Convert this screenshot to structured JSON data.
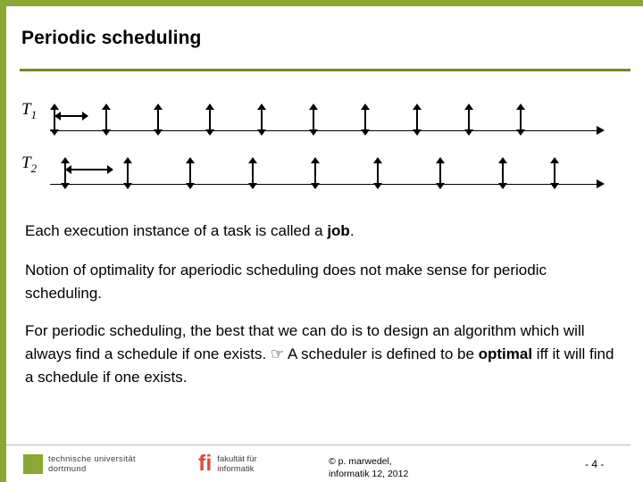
{
  "slide": {
    "title": "Periodic scheduling",
    "accent_color": "#8aa832",
    "rule_color": "#6f8a28"
  },
  "diagram": {
    "tasks": [
      {
        "label": "T",
        "subscript": "1"
      },
      {
        "label": "T",
        "subscript": "2"
      }
    ],
    "row1_markers": [
      60,
      118,
      176,
      234,
      292,
      350,
      408,
      466,
      524,
      582
    ],
    "row2_markers": [
      72,
      142,
      212,
      282,
      352,
      422,
      492,
      562,
      620
    ],
    "row1_period_arrow": {
      "start": 62,
      "end": 100
    },
    "row2_period_arrow": {
      "start": 74,
      "end": 128
    }
  },
  "content": {
    "paragraph1_a": "Each execution instance of a task is called a ",
    "paragraph1_b": "job",
    "paragraph1_c": ".",
    "paragraph2": "Notion of optimality for aperiodic scheduling does not make sense for periodic scheduling.",
    "paragraph3_a": "For periodic scheduling, the best that we can do is to design an algorithm which will always find a schedule if one exists.",
    "paragraph3_pointer": "☞",
    "paragraph3_b": " A scheduler is defined to be ",
    "paragraph3_bold": "optimal",
    "paragraph3_c": " iff it will find a schedule if one exists."
  },
  "footer": {
    "tu_logo_line1": "technische universität",
    "tu_logo_line2": "dortmund",
    "fi_logo_mark": "fi",
    "fi_logo_line1": "fakultät für",
    "fi_logo_line2": "informatik",
    "copyright_line1": "© p. marwedel,",
    "copyright_line2": "informatik 12,  2012",
    "page_number": "-  4  -"
  }
}
